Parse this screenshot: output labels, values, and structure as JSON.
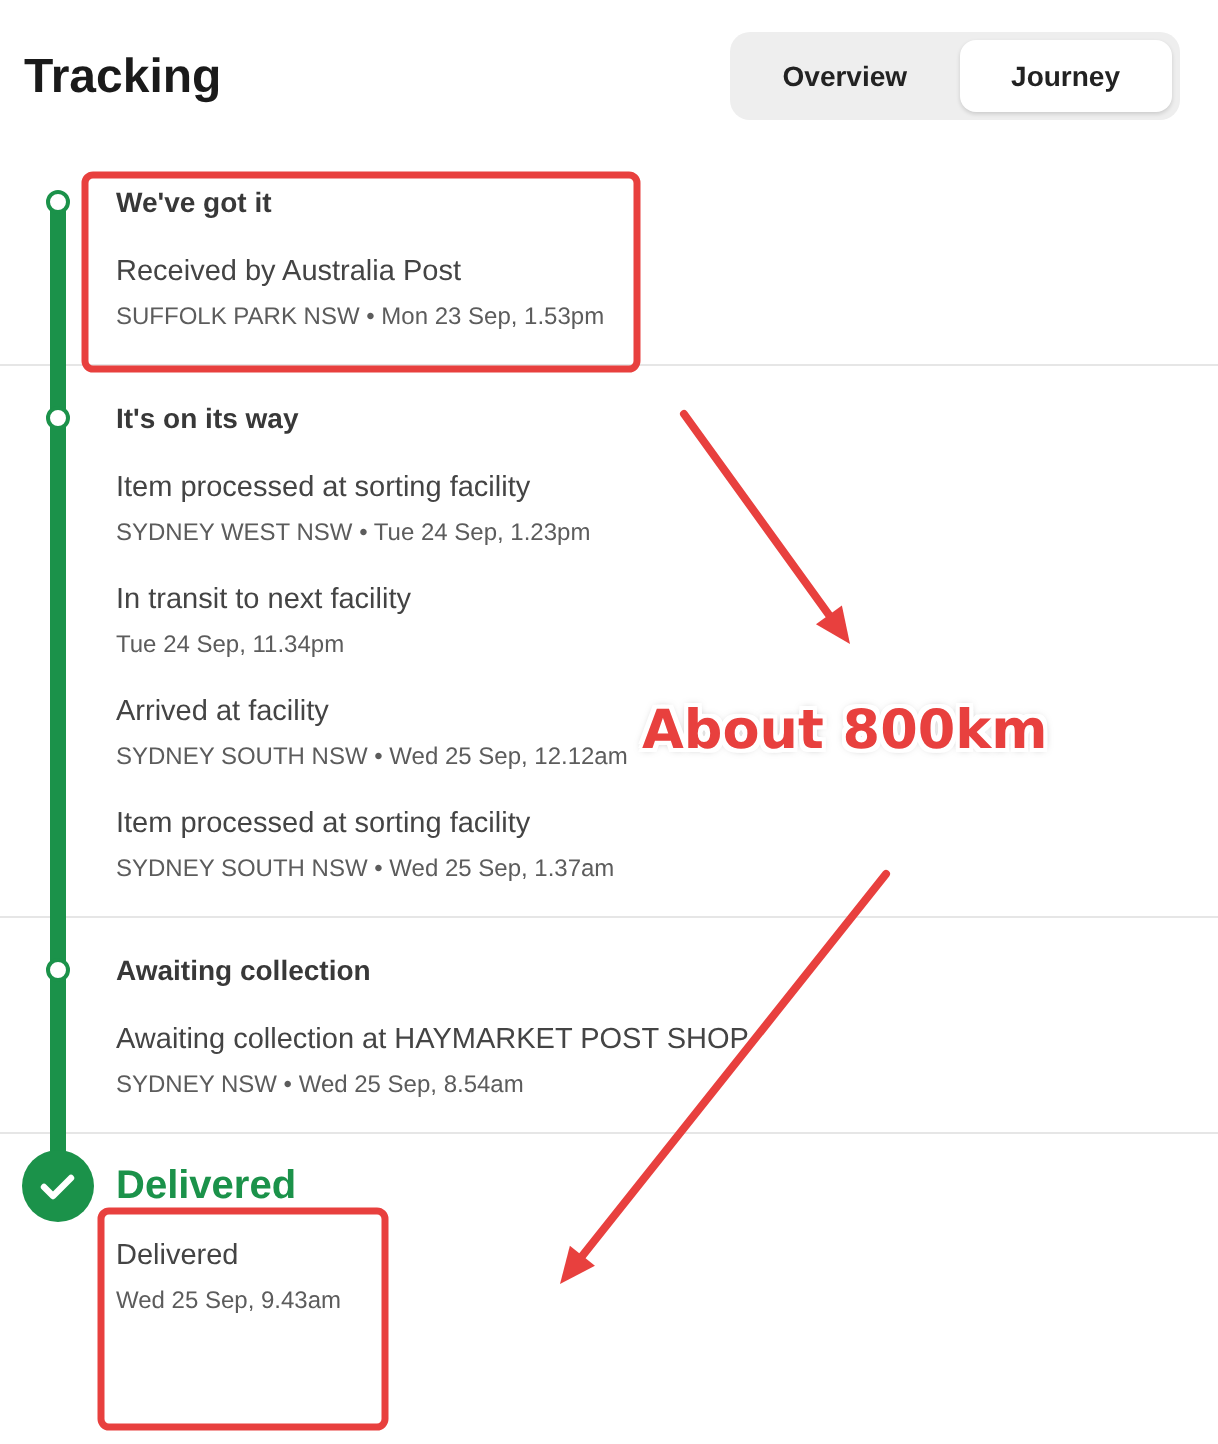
{
  "header": {
    "title": "Tracking",
    "tabs": [
      {
        "label": "Overview",
        "selected": false
      },
      {
        "label": "Journey",
        "selected": true
      }
    ]
  },
  "stages": [
    {
      "kind": "progress",
      "title": "We've got it",
      "events": [
        {
          "description": "Received by Australia Post",
          "detail": "SUFFOLK PARK NSW • Mon 23 Sep, 1.53pm"
        }
      ]
    },
    {
      "kind": "progress",
      "title": "It's on its way",
      "events": [
        {
          "description": "Item processed at sorting facility",
          "detail": "SYDNEY WEST NSW • Tue 24 Sep, 1.23pm"
        },
        {
          "description": "In transit to next facility",
          "detail": "Tue 24 Sep, 11.34pm"
        },
        {
          "description": "Arrived at facility",
          "detail": "SYDNEY SOUTH NSW • Wed 25 Sep, 12.12am"
        },
        {
          "description": "Item processed at sorting facility",
          "detail": "SYDNEY SOUTH NSW • Wed 25 Sep, 1.37am"
        }
      ]
    },
    {
      "kind": "progress",
      "title": "Awaiting collection",
      "events": [
        {
          "description": "Awaiting collection at HAYMARKET POST SHOP",
          "detail": "SYDNEY NSW • Wed 25 Sep, 8.54am"
        }
      ]
    },
    {
      "kind": "delivered",
      "title": "Delivered",
      "events": [
        {
          "description": "Delivered",
          "detail": "Wed 25 Sep, 9.43am"
        }
      ]
    }
  ],
  "annotation": {
    "label": "About 800km"
  }
}
